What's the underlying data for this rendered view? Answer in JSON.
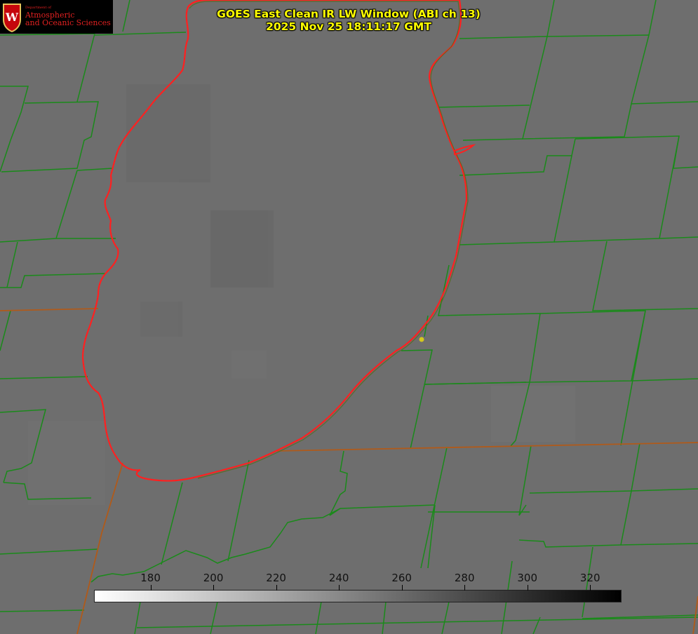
{
  "header": {
    "title_line1": "GOES East Clean IR LW Window (ABI ch 13)",
    "title_line2": "2025 Nov 25 18:11:17 GMT"
  },
  "logo": {
    "dept": "Department of",
    "line1": "Atmospheric",
    "line2": "and Oceanic Sciences",
    "crest_letter": "W"
  },
  "colorbar": {
    "ticks": [
      "180",
      "200",
      "220",
      "240",
      "260",
      "280",
      "300",
      "320"
    ],
    "range": [
      162,
      330
    ],
    "colormap": "white-to-black"
  },
  "colors": {
    "background": "#6e6e6e",
    "county_lines": "#1a8a1a",
    "state_lines": "#b05a1a",
    "lake_outline": "#ff2020",
    "title_text": "#ffff00",
    "marker": "#d4c81e"
  }
}
